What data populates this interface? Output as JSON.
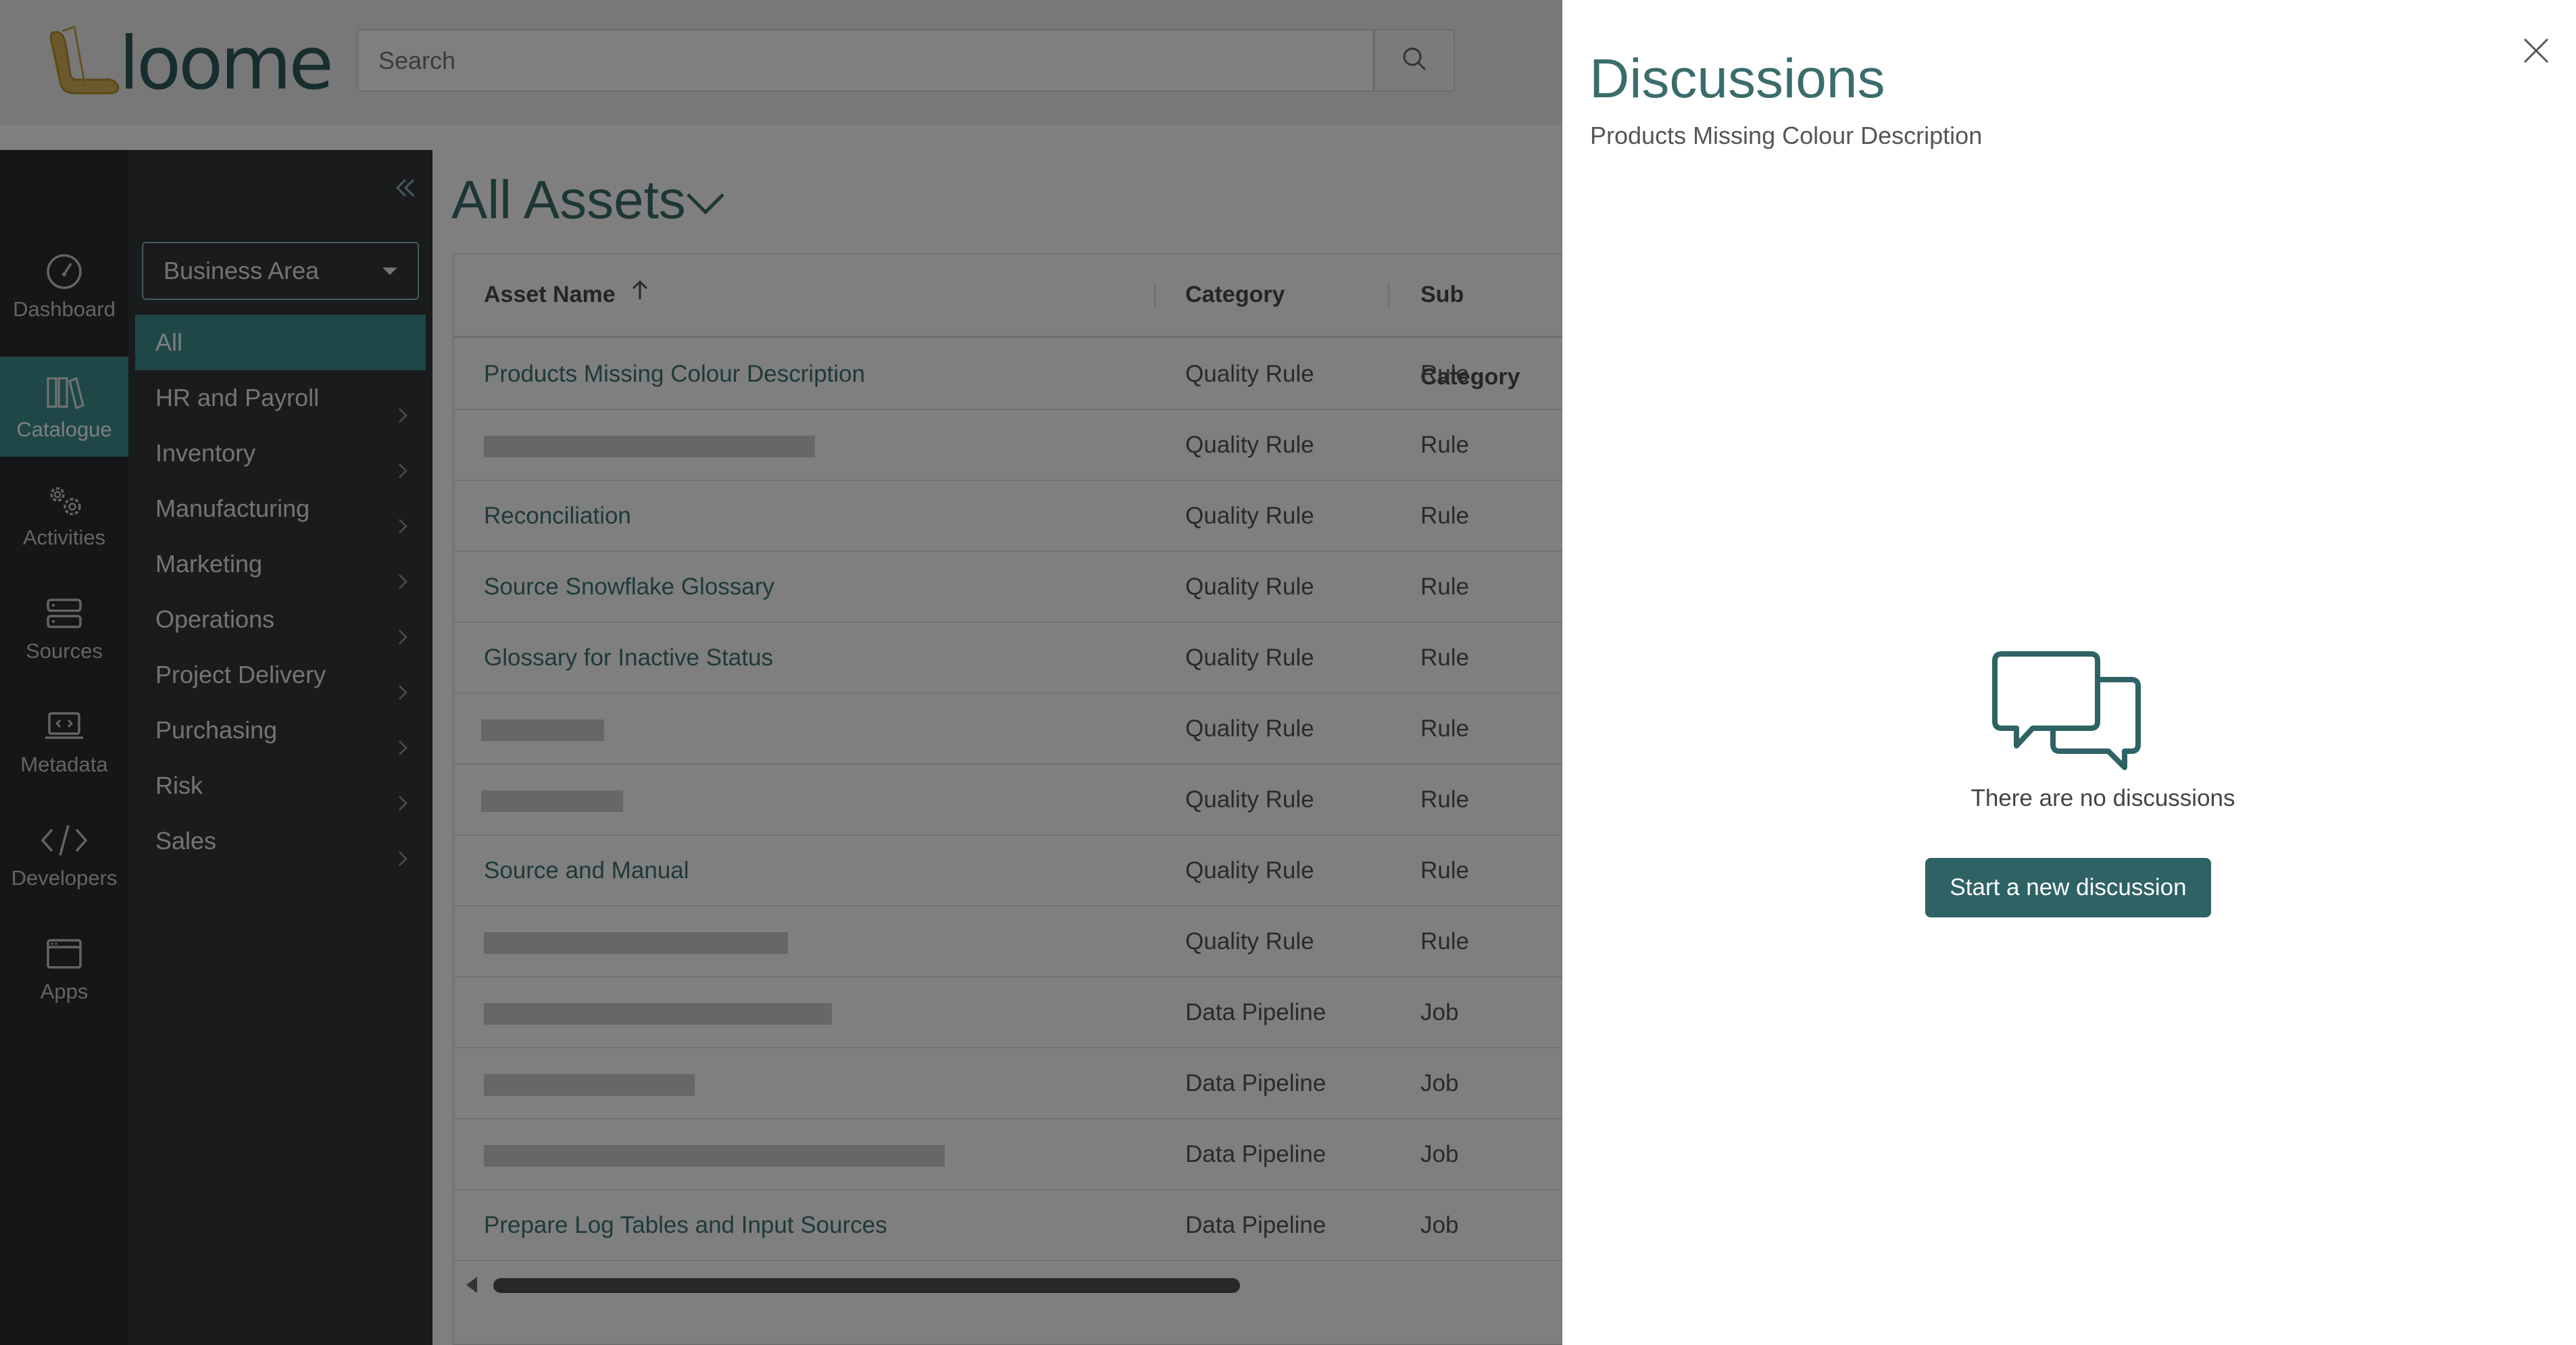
{
  "header": {
    "logo_text": "loome",
    "search_placeholder": "Search"
  },
  "rail": {
    "items": [
      {
        "label": "Dashboard",
        "icon": "speedometer-icon"
      },
      {
        "label": "Catalogue",
        "icon": "books-icon",
        "active": true
      },
      {
        "label": "Activities",
        "icon": "gears-icon"
      },
      {
        "label": "Sources",
        "icon": "server-icon"
      },
      {
        "label": "Metadata",
        "icon": "laptop-code-icon"
      },
      {
        "label": "Developers",
        "icon": "code-icon"
      },
      {
        "label": "Apps",
        "icon": "window-icon"
      }
    ]
  },
  "categories": {
    "filter_label": "Business Area",
    "items": [
      {
        "label": "All",
        "active": true
      },
      {
        "label": "HR and Payroll"
      },
      {
        "label": "Inventory"
      },
      {
        "label": "Manufacturing"
      },
      {
        "label": "Marketing"
      },
      {
        "label": "Operations"
      },
      {
        "label": "Project Delivery"
      },
      {
        "label": "Purchasing"
      },
      {
        "label": "Risk"
      },
      {
        "label": "Sales"
      }
    ]
  },
  "main": {
    "title": "All Assets",
    "columns": {
      "name": "Asset Name",
      "category": "Category",
      "subcategory": "Sub Category"
    },
    "rows": [
      {
        "name": "Products Missing Colour Description",
        "category": "Quality Rule",
        "subcategory": "Rule"
      },
      {
        "name": "",
        "redacted": true,
        "category": "Quality Rule",
        "subcategory": "Rule"
      },
      {
        "name": "Reconciliation",
        "category": "Quality Rule",
        "subcategory": "Rule"
      },
      {
        "name": "Source Snowflake Glossary",
        "category": "Quality Rule",
        "subcategory": "Rule"
      },
      {
        "name": "Glossary for Inactive Status",
        "category": "Quality Rule",
        "subcategory": "Rule"
      },
      {
        "name": "",
        "redacted": true,
        "category": "Quality Rule",
        "subcategory": "Rule"
      },
      {
        "name": "",
        "redacted": true,
        "category": "Quality Rule",
        "subcategory": "Rule"
      },
      {
        "name": "Source and Manual",
        "category": "Quality Rule",
        "subcategory": "Rule"
      },
      {
        "name": "",
        "redacted": true,
        "category": "Quality Rule",
        "subcategory": "Rule"
      },
      {
        "name": "",
        "redacted": true,
        "category": "Data Pipeline",
        "subcategory": "Job"
      },
      {
        "name": "",
        "redacted": true,
        "category": "Data Pipeline",
        "subcategory": "Job"
      },
      {
        "name": "",
        "redacted": true,
        "category": "Data Pipeline",
        "subcategory": "Job"
      },
      {
        "name": "Prepare Log Tables and Input Sources",
        "category": "Data Pipeline",
        "subcategory": "Job"
      }
    ]
  },
  "drawer": {
    "title": "Discussions",
    "subtitle": "Products Missing Colour Description",
    "empty_text": "There are no discussions",
    "button_label": "Start a new discussion"
  },
  "colors": {
    "accent": "#3f8f8e",
    "button": "#2f6264",
    "title": "#3a6c6c",
    "sidebar": "#2a2c2f"
  }
}
